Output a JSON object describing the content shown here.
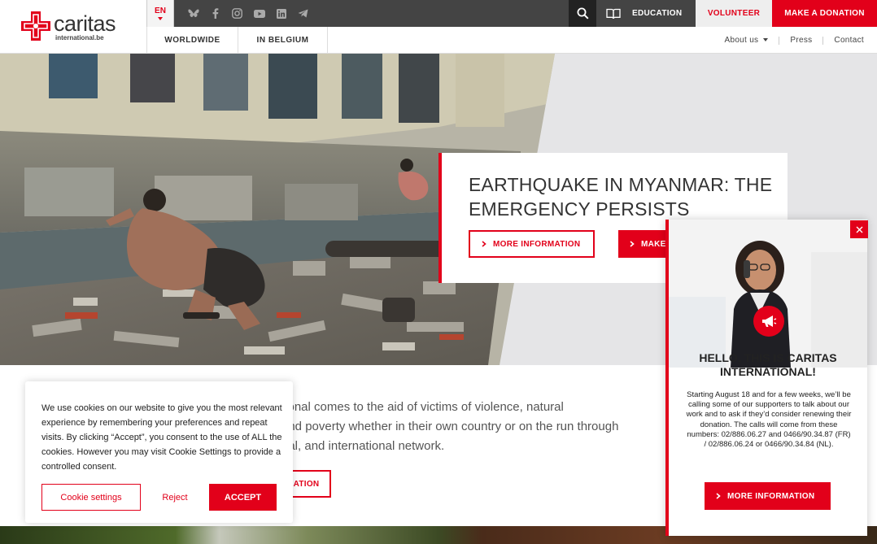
{
  "logo": {
    "name": "caritas",
    "sub": "international.be"
  },
  "topbar": {
    "language": "EN",
    "social_icons": [
      "bluesky-icon",
      "facebook-icon",
      "instagram-icon",
      "youtube-icon",
      "linkedin-icon",
      "telegram-icon"
    ],
    "education_label": "EDUCATION",
    "volunteer_label": "VOLUNTEER",
    "donate_label": "MAKE A DONATION"
  },
  "mainnav": {
    "tabs": [
      "WORLDWIDE",
      "IN BELGIUM"
    ]
  },
  "secnav": {
    "about": "About us",
    "press": "Press",
    "contact": "Contact"
  },
  "hero": {
    "title": "EARTHQUAKE IN MYANMAR: THE EMERGENCY PERSISTS",
    "more_info_label": "MORE INFORMATION",
    "donate_label": "MAKE"
  },
  "intro": {
    "text": "tional comes to the aid of victims of violence, natural\nand poverty whether in their own country or on the run through\nnal, and international network.",
    "button_label": "ATION"
  },
  "cookie": {
    "text": "We use cookies on our website to give you the most relevant experience by remembering your preferences and repeat visits. By clicking “Accept”, you consent to the use of ALL the cookies. However you may visit Cookie Settings to provide a controlled consent.",
    "settings_label": "Cookie settings",
    "reject_label": "Reject",
    "accept_label": "ACCEPT"
  },
  "popup": {
    "title": "HELLO, THIS IS CARITAS INTERNATIONAL!",
    "body": "Starting August 18 and for a few weeks, we’ll be calling some of our supporters to talk about our work and to ask if they’d consider renewing their donation. The calls will come from these numbers: 02/886.06.27 and 0466/90.34.87 (FR) / 02/886.06.24 or 0466/90.34.84 (NL).",
    "button_label": "MORE INFORMATION"
  },
  "colors": {
    "brand_red": "#e2001a",
    "dark_bar": "#444444",
    "hero_bg": "#e5e5e7"
  }
}
